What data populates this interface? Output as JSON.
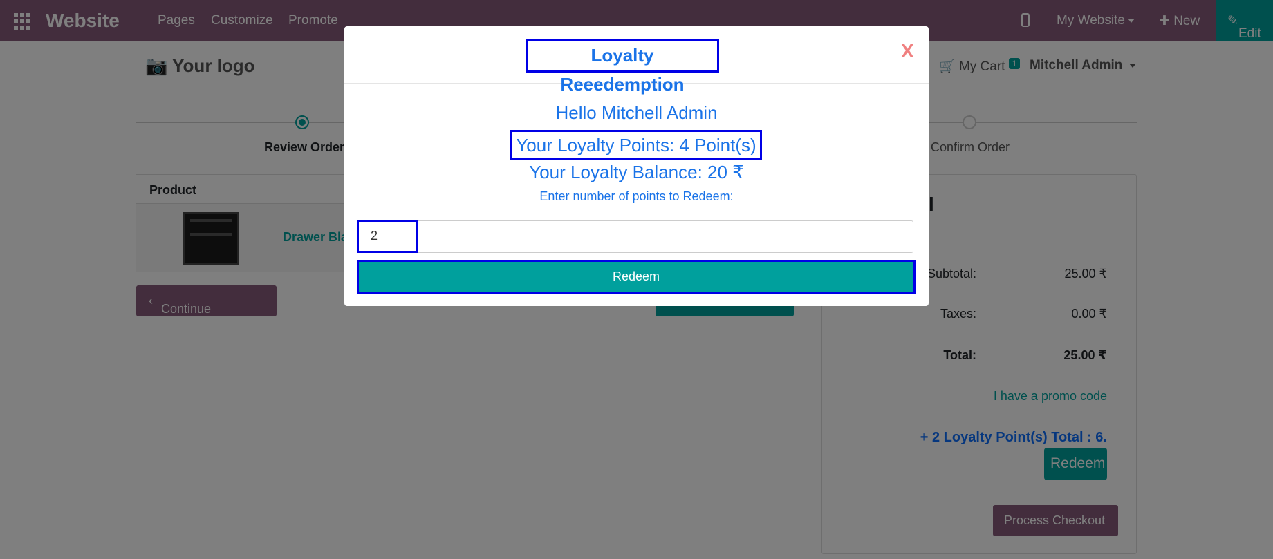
{
  "topbar": {
    "brand": "Website",
    "menu": [
      "Pages",
      "Customize",
      "Promote"
    ],
    "site_selector": "My Website",
    "new_label": "New",
    "edit_label": "Edit",
    "bg_color": "#875a7b",
    "edit_color": "#00a09d"
  },
  "header": {
    "logo": "Your logo",
    "cart_label": "My Cart",
    "cart_count": "1",
    "user": "Mitchell Admin"
  },
  "steps": [
    "Review Order",
    "Confirm Order"
  ],
  "product_table": {
    "header": "Product",
    "row_name": "Drawer Bla"
  },
  "continue_label": "Continue Shopping",
  "summary": {
    "title": "l",
    "rows": [
      {
        "label": "Subtotal:",
        "value": "25.00 ₹"
      },
      {
        "label": "Taxes:",
        "value": "0.00 ₹"
      },
      {
        "label": "Total:",
        "value": "25.00 ₹"
      }
    ],
    "promo": "I have a promo code",
    "loyalty_total": "+ 2 Loyalty Point(s) Total : 6.",
    "redeem_label": "Redeem",
    "checkout_label": "Process Checkout"
  },
  "modal": {
    "title": "Loyalty Reeedemption",
    "close": "X",
    "greeting": "Hello Mitchell Admin",
    "points": "Your Loyalty Points: 4 Point(s)",
    "balance": "Your Loyalty Balance: 20 ₹",
    "prompt": "Enter number of points to Redeem:",
    "input_value": "2",
    "redeem_label": "Redeem",
    "highlight_color": "#0000e6",
    "text_color": "#1a73e8"
  }
}
